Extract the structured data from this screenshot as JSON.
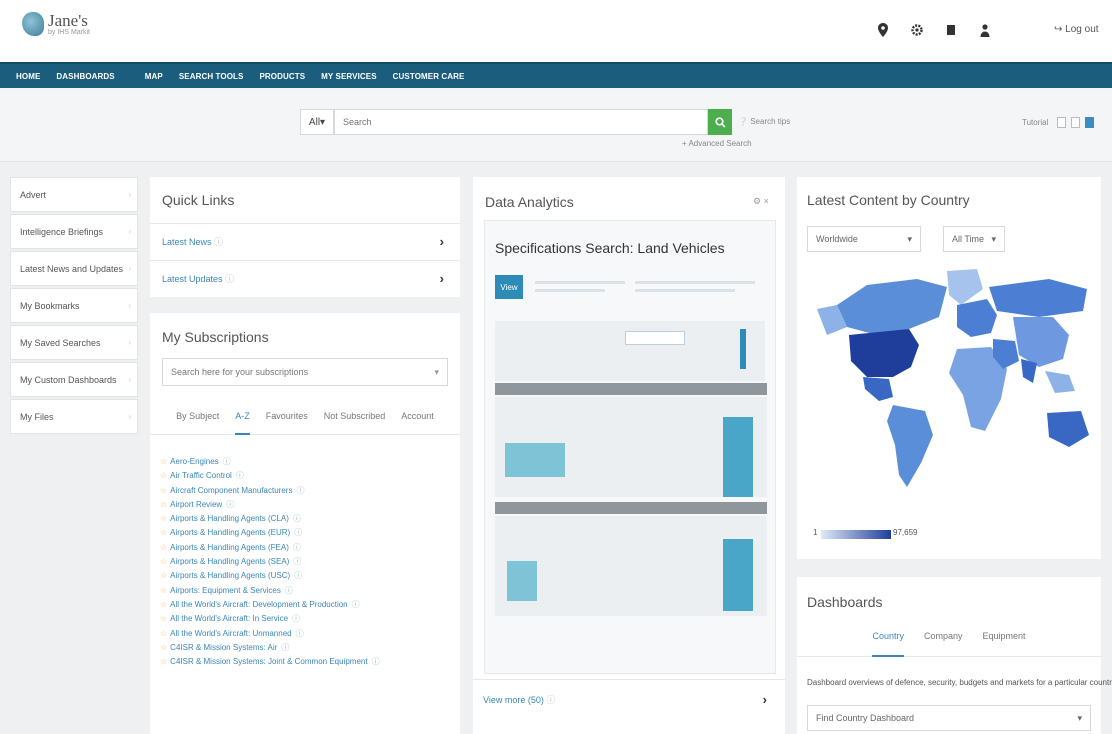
{
  "header": {
    "logo_text": "Jane's",
    "logo_sub": "by IHS Markit",
    "logout_label": "Log out",
    "icons": [
      "location-icon",
      "settings-icon",
      "bookmark-icon",
      "user-icon"
    ]
  },
  "nav": {
    "items_left": [
      "HOME",
      "DASHBOARDS"
    ],
    "items_right": [
      "MAP",
      "SEARCH TOOLS",
      "PRODUCTS",
      "MY SERVICES",
      "CUSTOMER CARE"
    ]
  },
  "search": {
    "scope": "All",
    "placeholder": "Search",
    "tips_label": "Search tips",
    "advanced_label": "+ Advanced Search",
    "tutorial_label": "Tutorial",
    "accent": "#4cae4c"
  },
  "sidebar": {
    "items": [
      {
        "label": "Advert"
      },
      {
        "label": "Intelligence Briefings"
      },
      {
        "label": "Latest News and Updates"
      },
      {
        "label": "My Bookmarks"
      },
      {
        "label": "My Saved Searches"
      },
      {
        "label": "My Custom Dashboards"
      },
      {
        "label": "My Files"
      }
    ]
  },
  "quick_links": {
    "title": "Quick Links",
    "items": [
      {
        "label": "Latest News"
      },
      {
        "label": "Latest Updates"
      }
    ]
  },
  "subscriptions": {
    "title": "My Subscriptions",
    "search_placeholder": "Search here for your subscriptions",
    "tabs": [
      "By Subject",
      "A-Z",
      "Favourites",
      "Not Subscribed",
      "Account"
    ],
    "active_tab": "A-Z",
    "items": [
      "Aero-Engines",
      "Air Traffic Control",
      "Aircraft Component Manufacturers",
      "Airport Review",
      "Airports & Handling Agents (CLA)",
      "Airports & Handling Agents (EUR)",
      "Airports & Handling Agents (FEA)",
      "Airports & Handling Agents (SEA)",
      "Airports & Handling Agents (USC)",
      "Airports: Equipment & Services",
      "All the World's Aircraft: Development & Production",
      "All the World's Aircraft: In Service",
      "All the World's Aircraft: Unmanned",
      "C4ISR & Mission Systems: Air",
      "C4ISR & Mission Systems: Joint & Common Equipment"
    ]
  },
  "data_analytics": {
    "title": "Data Analytics",
    "card_title": "Specifications Search: Land Vehicles",
    "view_label": "View",
    "footer_label": "View more (50)",
    "slide_count": 5,
    "active_slide": 4
  },
  "latest_content": {
    "title": "Latest Content by Country",
    "region": "Worldwide",
    "period": "All Time",
    "legend_min": "1",
    "legend_max": "97,659",
    "low_color": "#dfe9f7",
    "high_color": "#1f3e9c"
  },
  "dashboards": {
    "title": "Dashboards",
    "tabs": [
      "Country",
      "Company",
      "Equipment"
    ],
    "active_tab": "Country",
    "description": "Dashboard overviews of defence, security, budgets and markets for a particular country",
    "select_label": "Find Country Dashboard"
  }
}
